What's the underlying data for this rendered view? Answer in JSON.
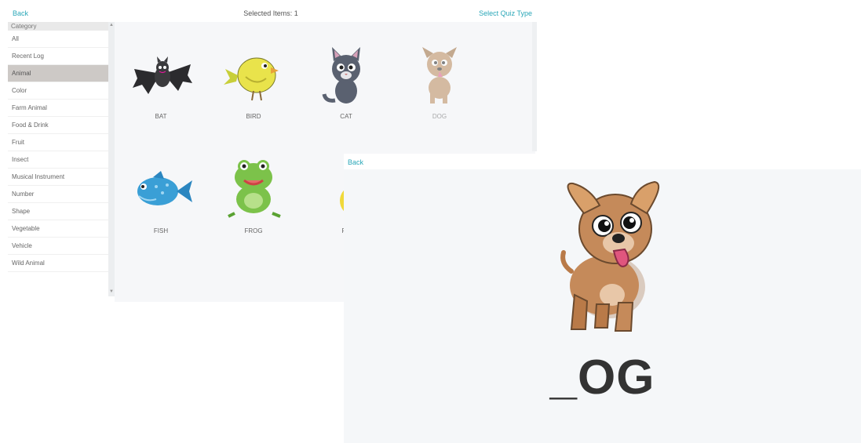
{
  "header": {
    "back_label": "Back",
    "selected_label": "Selected Items: 1",
    "quiz_type_label": "Select Quiz Type"
  },
  "sidebar": {
    "header": "Category",
    "items": [
      "All",
      "Recent Log",
      "Animal",
      "Color",
      "Farm Animal",
      "Food & Drink",
      "Fruit",
      "Insect",
      "Musical Instrument",
      "Number",
      "Shape",
      "Vegetable",
      "Vehicle",
      "Wild Animal"
    ],
    "active": "Animal"
  },
  "grid": {
    "items": [
      {
        "label": "BAT",
        "icon": "bat-icon"
      },
      {
        "label": "BIRD",
        "icon": "bird-icon"
      },
      {
        "label": "CAT",
        "icon": "cat-icon"
      },
      {
        "label": "DOG",
        "icon": "dog-icon"
      },
      {
        "label": "FISH",
        "icon": "fish-icon"
      },
      {
        "label": "FROG",
        "icon": "frog-icon"
      },
      {
        "label": "RA",
        "icon": "rabbit-icon"
      }
    ]
  },
  "detail": {
    "back_label": "Back",
    "word": "_OG",
    "icon": "dog-icon"
  },
  "colors": {
    "accent": "#2aa7b8",
    "active_bg": "#cdc9c6"
  }
}
